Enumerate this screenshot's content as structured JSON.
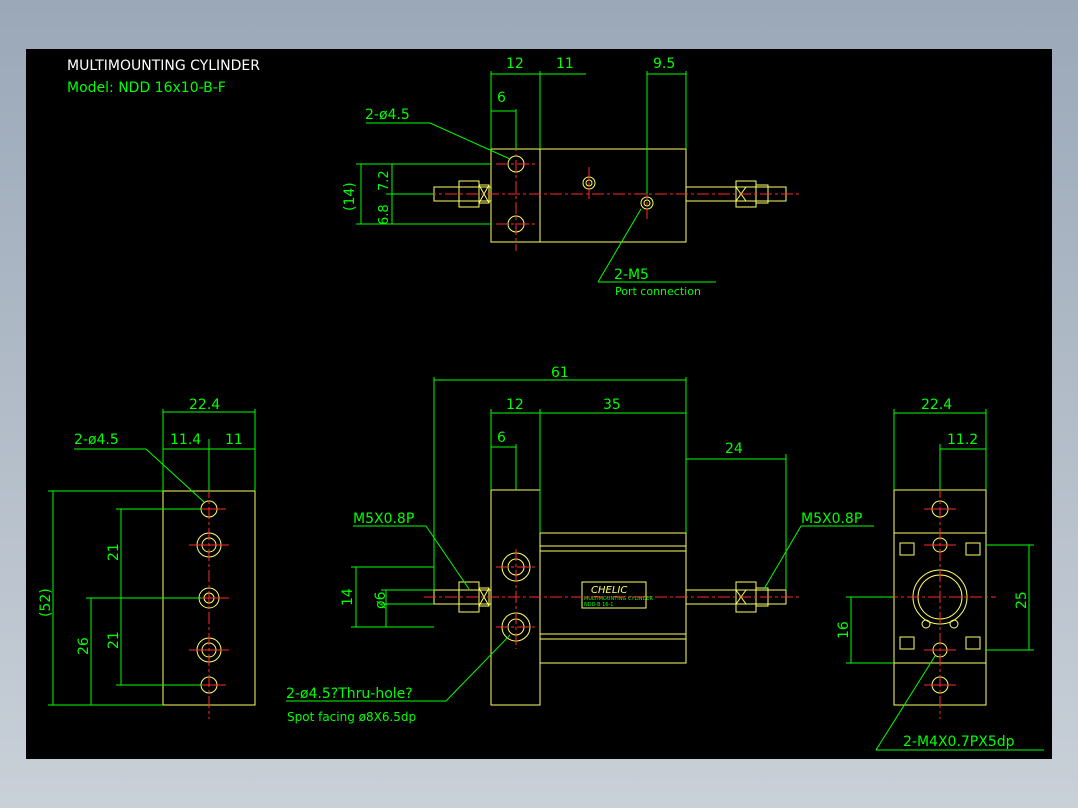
{
  "header": {
    "title": "MULTIMOUNTING CYLINDER",
    "model": "Model: NDD 16x10-B-F"
  },
  "top_view": {
    "dim_12": "12",
    "dim_11": "11",
    "dim_9_5": "9.5",
    "dim_6": "6",
    "hole_callout": "2-ø4.5",
    "dim_14": "(14)",
    "dim_6_8": "6.8",
    "dim_7_2": "7.2",
    "port_callout": "2-M5",
    "port_note": "Port connection"
  },
  "front_view": {
    "dim_61": "61",
    "dim_12": "12",
    "dim_35": "35",
    "dim_6": "6",
    "dim_24": "24",
    "thread_left": "M5X0.8P",
    "thread_right": "M5X0.8P",
    "dim_14": "14",
    "dim_dia6": "ø6",
    "hole_callout": "2-ø4.5?Thru-hole?",
    "spot_facing": "Spot facing  ø8X6.5dp",
    "badge_brand": "CHELIC",
    "badge_line1": "MULTIMOUNTING CYLINDER",
    "badge_line2": "NDD-B 16-1"
  },
  "left_view": {
    "dim_22_4": "22.4",
    "dim_11_4": "11.4",
    "dim_11": "11",
    "hole_callout": "2-ø4.5",
    "dim_52": "(52)",
    "dim_21a": "21",
    "dim_21b": "21",
    "dim_26": "26"
  },
  "right_view": {
    "dim_22_4": "22.4",
    "dim_11_2": "11.2",
    "dim_25": "25",
    "dim_16": "16",
    "thread_callout": "2-M4X0.7PX5dp"
  },
  "colors": {
    "background": "#000000",
    "dimension": "#00ff00",
    "outline": "#ffff66",
    "centerline": "#ff2a2a",
    "title": "#ffffff"
  }
}
